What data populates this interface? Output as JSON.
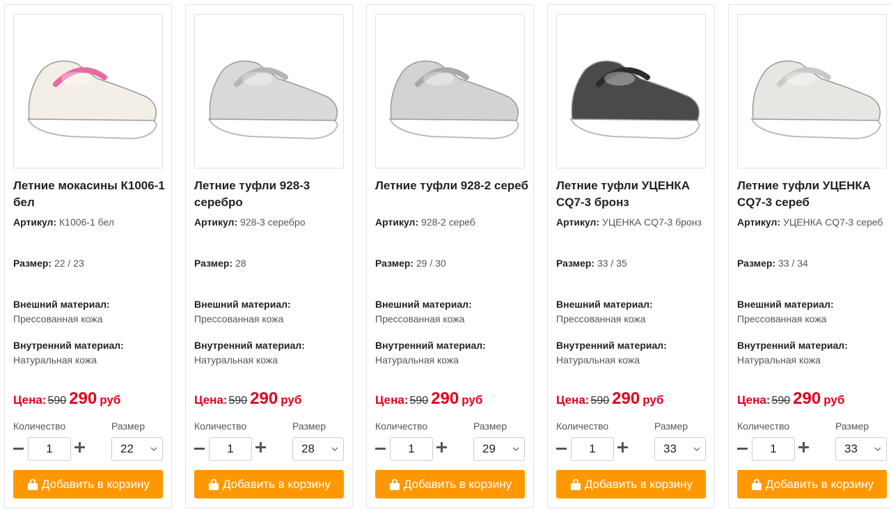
{
  "labels": {
    "article": "Артикул:",
    "size": "Размер:",
    "outer_material": "Внешний материал:",
    "inner_material": "Внутренний материал:",
    "price": "Цена:",
    "quantity": "Количество",
    "size_select": "Размер",
    "add_to_cart": "Добавить в корзину",
    "currency": "руб"
  },
  "colors": {
    "accent": "#ff9800",
    "price_red": "#e2001a"
  },
  "products": [
    {
      "title": "Летние мокасины К1006-1 бел",
      "article": "К1006-1 бел",
      "sizes": "22 / 23",
      "outer": "Прессованная кожа",
      "inner": "Натуральная кожа",
      "old_price": "590",
      "new_price": "290",
      "qty": "1",
      "selected_size": "22",
      "shoe_color": "#f4efe6",
      "shoe_accent": "#e96aa0"
    },
    {
      "title": "Летние туфли 928-3 серебро",
      "article": "928-3 серебро",
      "sizes": "28",
      "outer": "Прессованная кожа",
      "inner": "Натуральная кожа",
      "old_price": "590",
      "new_price": "290",
      "qty": "1",
      "selected_size": "28",
      "shoe_color": "#d9d9d9",
      "shoe_accent": "#b5b5b5"
    },
    {
      "title": "Летние туфли 928-2 сереб",
      "article": "928-2 сереб",
      "sizes": "29 / 30",
      "outer": "Прессованная кожа",
      "inner": "Натуральная кожа",
      "old_price": "590",
      "new_price": "290",
      "qty": "1",
      "selected_size": "29",
      "shoe_color": "#d3d3d3",
      "shoe_accent": "#a9a9a9"
    },
    {
      "title": "Летние туфли УЦЕНКА CQ7-3 бронз",
      "article": "УЦЕНКА CQ7-3 бронз",
      "sizes": "33 / 35",
      "outer": "Прессованная кожа",
      "inner": "Натуральная кожа",
      "old_price": "590",
      "new_price": "290",
      "qty": "1",
      "selected_size": "33",
      "shoe_color": "#4a4a4a",
      "shoe_accent": "#2b2b2b"
    },
    {
      "title": "Летние туфли УЦЕНКА CQ7-3 сереб",
      "article": "УЦЕНКА CQ7-3 сереб",
      "sizes": "33 / 34",
      "outer": "Прессованная кожа",
      "inner": "Натуральная кожа",
      "old_price": "590",
      "new_price": "290",
      "qty": "1",
      "selected_size": "33",
      "shoe_color": "#e6e6e3",
      "shoe_accent": "#c8c8c4"
    }
  ]
}
